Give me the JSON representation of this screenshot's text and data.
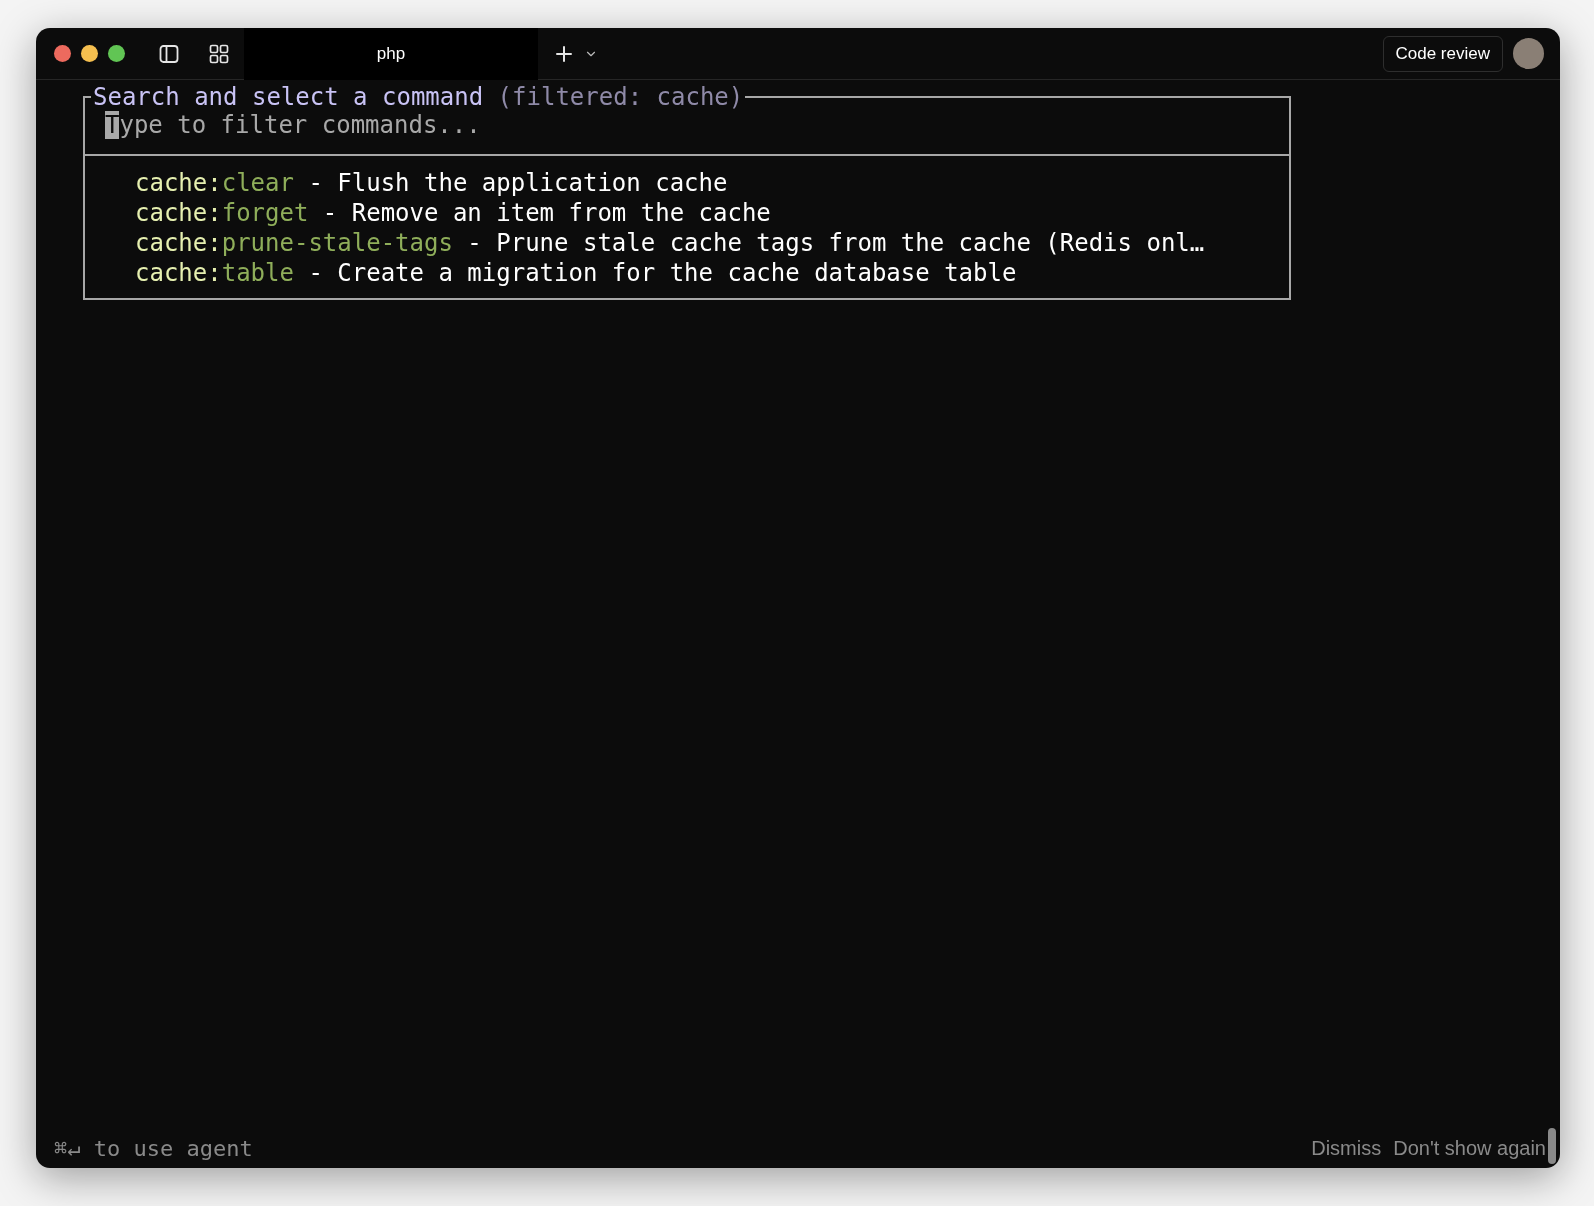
{
  "window": {
    "tabs": [
      {
        "label": "php",
        "selected": true
      }
    ],
    "code_review_button": "Code review"
  },
  "palette": {
    "title": "Search and select a command",
    "filter_note": "(filtered: cache)",
    "placeholder": "Type to filter commands...",
    "commands": [
      {
        "prefix": "cache:",
        "name": "clear",
        "description": "- Flush the application cache"
      },
      {
        "prefix": "cache:",
        "name": "forget",
        "description": "- Remove an item from the cache"
      },
      {
        "prefix": "cache:",
        "name": "prune-stale-tags",
        "description": "- Prune stale cache tags from the cache (Redis onl…"
      },
      {
        "prefix": "cache:",
        "name": "table",
        "description": "- Create a migration for the cache database table"
      }
    ]
  },
  "footer": {
    "hint_keys": "⌘↵",
    "hint": "to use agent",
    "actions": [
      "Dismiss",
      "Don't show again"
    ]
  }
}
